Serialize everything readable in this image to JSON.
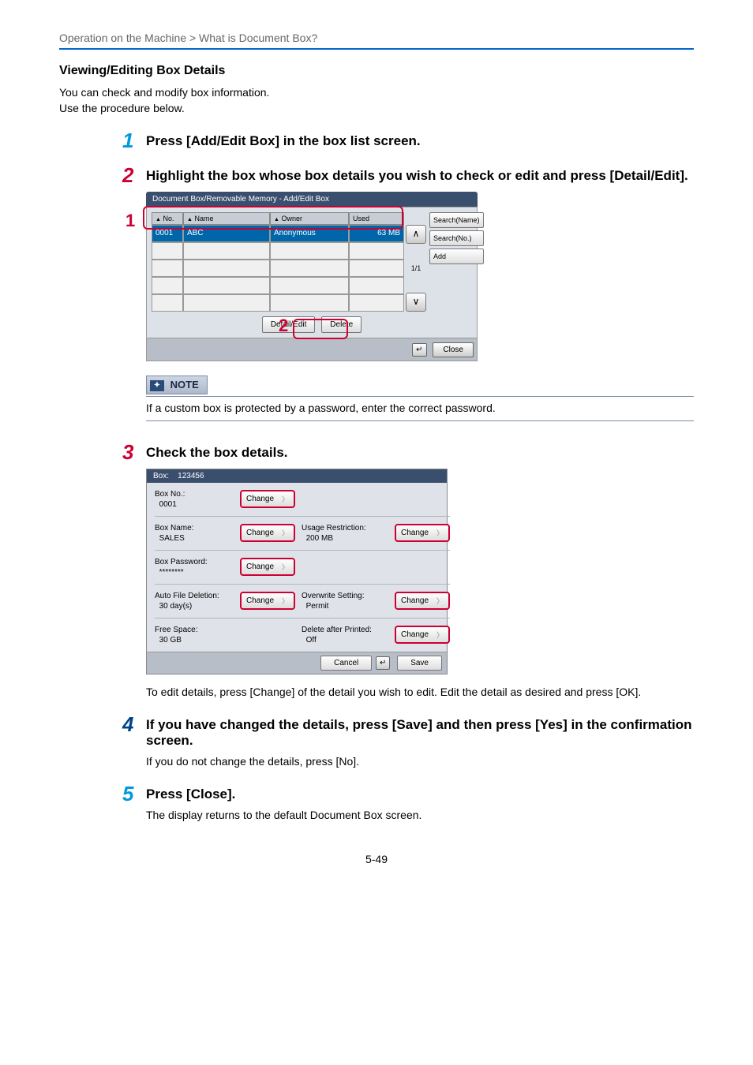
{
  "breadcrumb": "Operation on the Machine > What is Document Box?",
  "section_title": "Viewing/Editing Box Details",
  "intro1": "You can check and modify box information.",
  "intro2": "Use the procedure below.",
  "steps": {
    "s1": {
      "title": "Press [Add/Edit Box] in the box list screen."
    },
    "s2": {
      "title": "Highlight the box whose box details you wish to check or edit and press [Detail/Edit]."
    },
    "s3": {
      "title": "Check the box details."
    },
    "s4": {
      "title": "If you have changed the details, press [Save] and then press [Yes] in the confirmation screen.",
      "body": "If you do not change the details, press [No]."
    },
    "s5": {
      "title": "Press [Close].",
      "body": "The display returns to the default Document Box screen."
    }
  },
  "shot1": {
    "title": "Document Box/Removable Memory - Add/Edit Box",
    "head_no": "No.",
    "head_name": "Name",
    "head_owner": "Owner",
    "head_used": "Used",
    "row_no": "0001",
    "row_name": "ABC",
    "row_owner": "Anonymous",
    "row_used": "63 MB",
    "page": "1/1",
    "btn_search_name": "Search(Name)",
    "btn_search_no": "Search(No.)",
    "btn_add": "Add",
    "btn_detail": "Detail/Edit",
    "btn_delete": "Delete",
    "btn_close": "Close",
    "enter": "↵",
    "callout1": "1",
    "callout2": "2"
  },
  "note": {
    "label": "NOTE",
    "text": "If a custom box is protected by a password, enter the correct password."
  },
  "shot2": {
    "title_prefix": "Box:",
    "title_val": "123456",
    "boxno_l": "Box No.:",
    "boxno_v": "0001",
    "boxname_l": "Box Name:",
    "boxname_v": "SALES",
    "boxpw_l": "Box Password:",
    "boxpw_v": "********",
    "autodel_l": "Auto File Deletion:",
    "autodel_v": "30  day(s)",
    "free_l": "Free Space:",
    "free_v": "30  GB",
    "usage_l": "Usage Restriction:",
    "usage_v": "200  MB",
    "over_l": "Overwrite Setting:",
    "over_v": "Permit",
    "delafter_l": "Delete after Printed:",
    "delafter_v": "Off",
    "change": "Change",
    "cancel": "Cancel",
    "save": "Save",
    "enter": "↵"
  },
  "s3_body": "To edit details, press [Change] of the detail you wish to edit. Edit the detail as desired and press [OK].",
  "page_num": "5-49"
}
